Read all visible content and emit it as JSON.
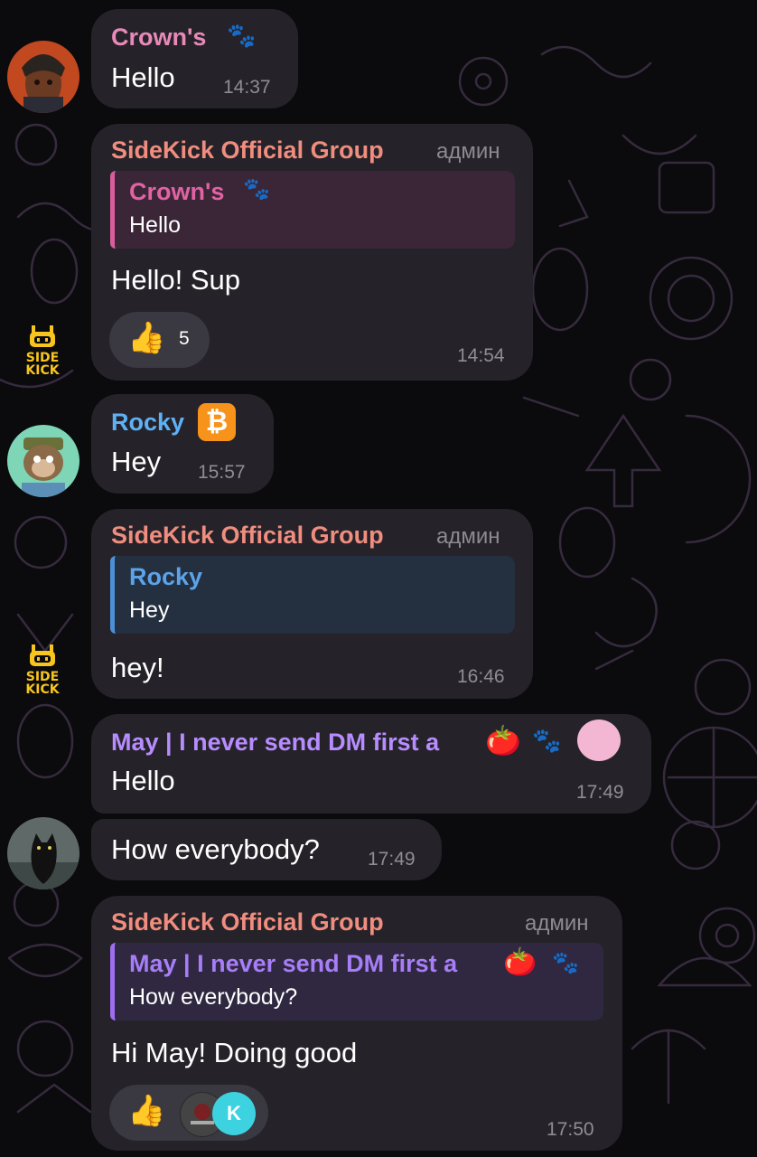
{
  "colors": {
    "crown": "#e889b9",
    "sidekick": "#f08d7f",
    "rocky": "#5eb1f5",
    "may": "#b78cff",
    "bubble": "#252329"
  },
  "messages": [
    {
      "sender": "Crown's",
      "badge": "paw-icon",
      "text": "Hello",
      "time": "14:37"
    },
    {
      "sender": "SideKick Official Group",
      "role": "админ",
      "reply_to": {
        "name": "Crown's",
        "text": "Hello"
      },
      "text": "Hello! Sup",
      "reaction": {
        "emoji": "👍",
        "count": "5"
      },
      "time": "14:54"
    },
    {
      "sender": "Rocky",
      "badge": "bitcoin-icon",
      "text": "Hey",
      "time": "15:57"
    },
    {
      "sender": "SideKick Official Group",
      "role": "админ",
      "reply_to": {
        "name": "Rocky",
        "text": "Hey"
      },
      "text": "hey!",
      "time": "16:46"
    },
    {
      "sender": "May | I never send DM first a",
      "badge": "tomato-icon",
      "text": "Hello",
      "time": "17:49"
    },
    {
      "text": "How everybody?",
      "time": "17:49"
    },
    {
      "sender": "SideKick Official Group",
      "role": "админ",
      "reply_to": {
        "name": "May | I never send DM first a",
        "text": "How everybody?"
      },
      "text": "Hi May! Doing good",
      "reaction": {
        "emoji": "👍",
        "avatars": [
          "reactor-avatar",
          "K"
        ]
      },
      "time": "17:50"
    }
  ],
  "icons": {
    "bitcoin": "₿",
    "tomato": "🍅",
    "paw": "🐾",
    "thumbs_up": "👍"
  },
  "sidekick_logo": {
    "line1": "SIDE",
    "line2": "KICK"
  }
}
